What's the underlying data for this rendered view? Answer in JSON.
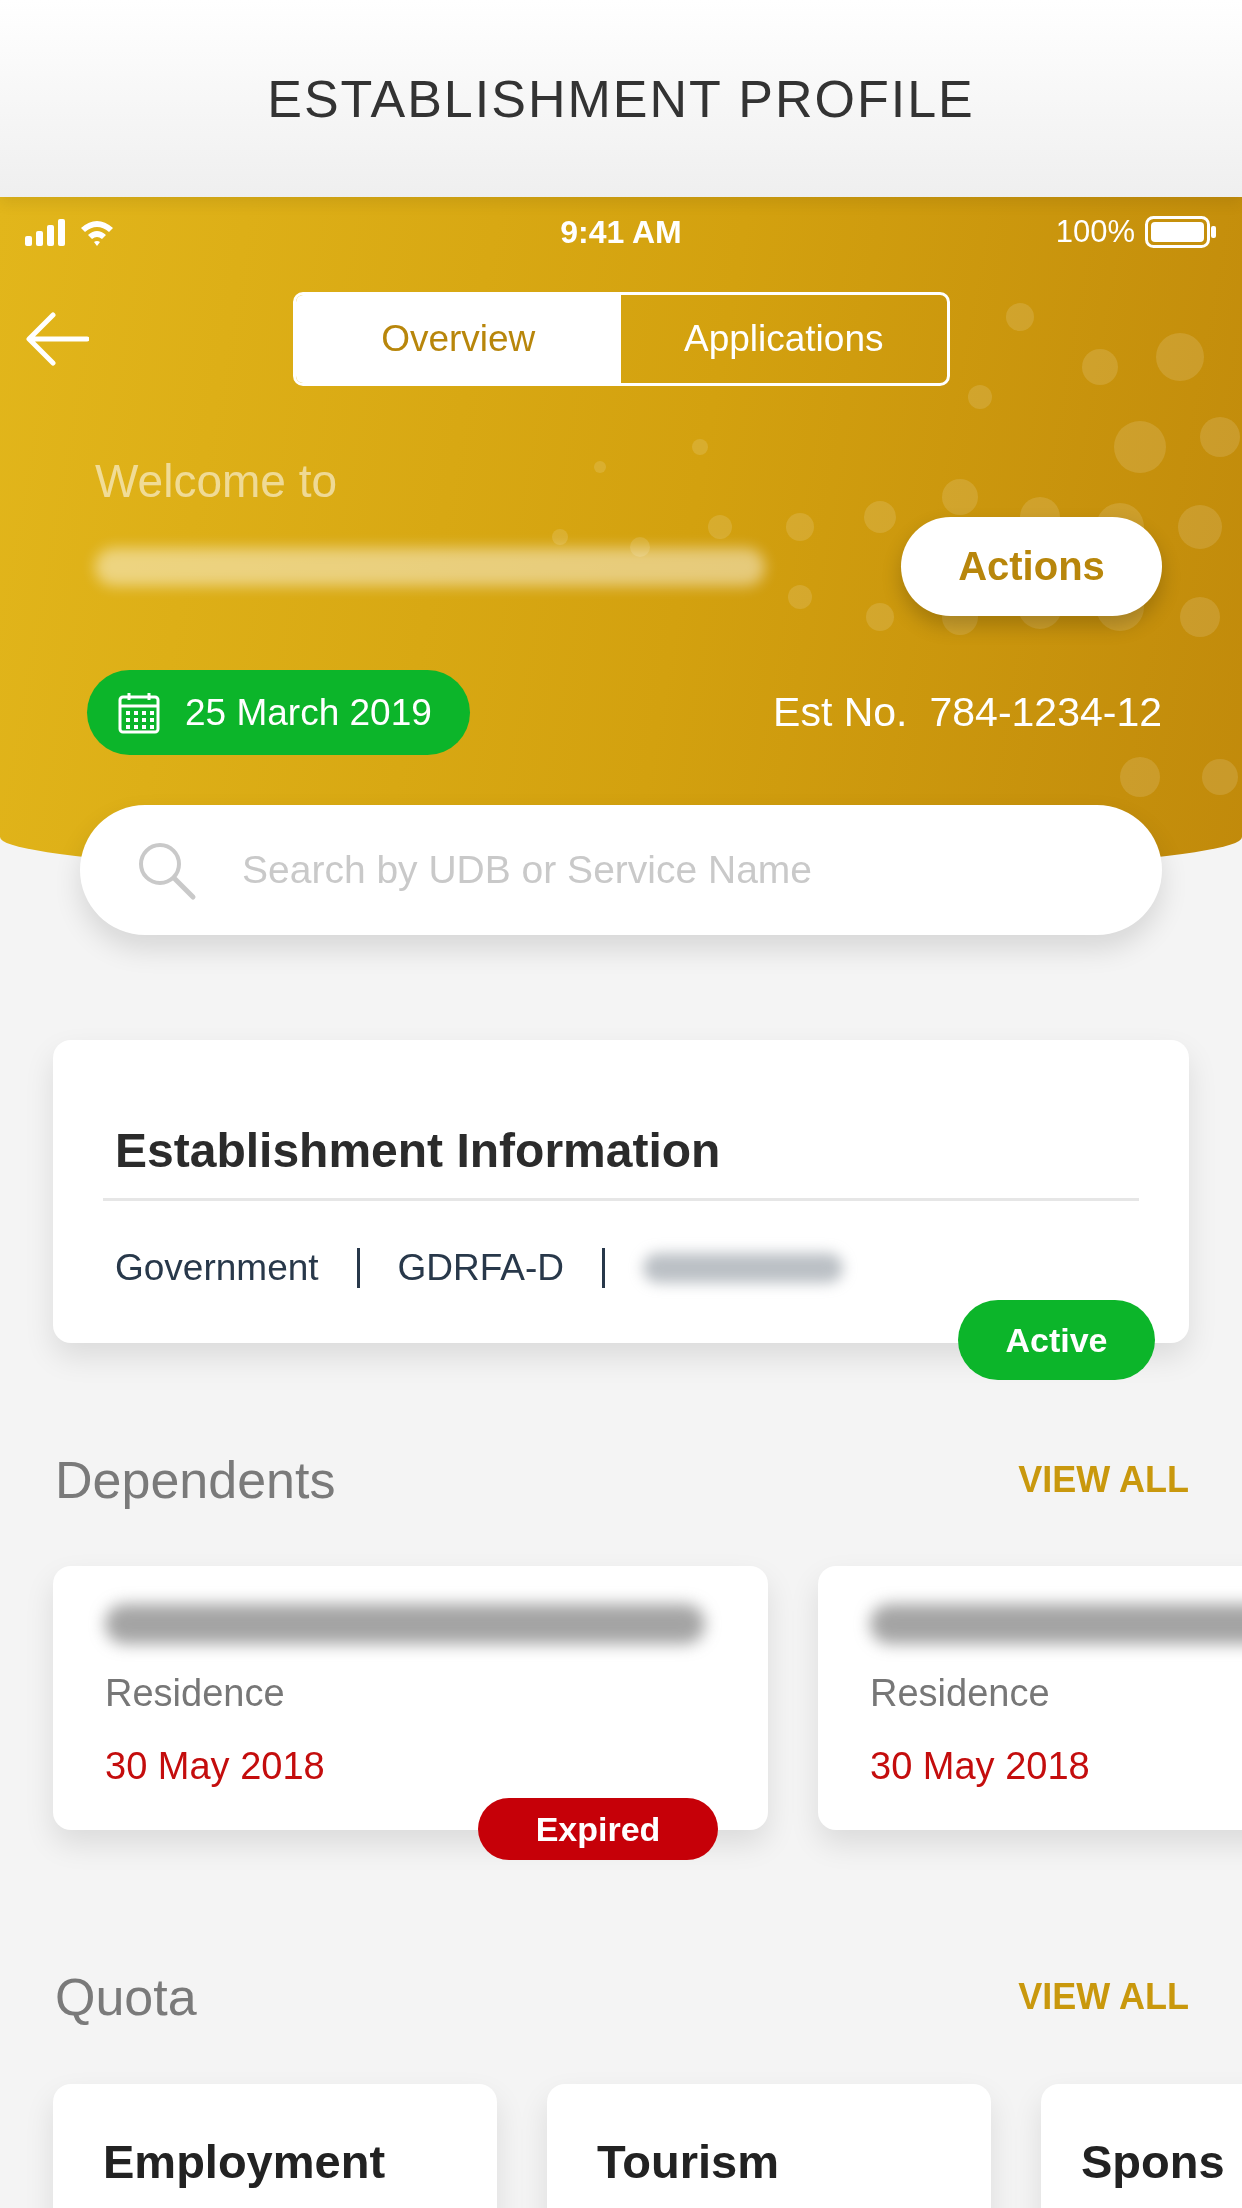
{
  "page_title": "ESTABLISHMENT PROFILE",
  "status_bar": {
    "time": "9:41 AM",
    "battery": "100%"
  },
  "tabs": [
    {
      "label": "Overview",
      "selected": true
    },
    {
      "label": "Applications",
      "selected": false
    }
  ],
  "header": {
    "welcome": "Welcome to",
    "action_button": "Actions",
    "date": "25 March 2019",
    "est_label": "Est No.",
    "est_number": "784-1234-12"
  },
  "search": {
    "placeholder": "Search by UDB or Service Name"
  },
  "establishment": {
    "title": "Establishment Information",
    "details": [
      "Government",
      "GDRFA-D"
    ],
    "status": "Active"
  },
  "dependents": {
    "title": "Dependents",
    "view_all": "VIEW ALL",
    "items": [
      {
        "type": "Residence",
        "date": "30 May 2018",
        "status": "Expired"
      },
      {
        "type": "Residence",
        "date": "30 May 2018"
      }
    ]
  },
  "quota": {
    "title": "Quota",
    "view_all": "VIEW ALL",
    "items": [
      {
        "name": "Employment"
      },
      {
        "name": "Tourism"
      },
      {
        "name": "Spons"
      }
    ]
  }
}
